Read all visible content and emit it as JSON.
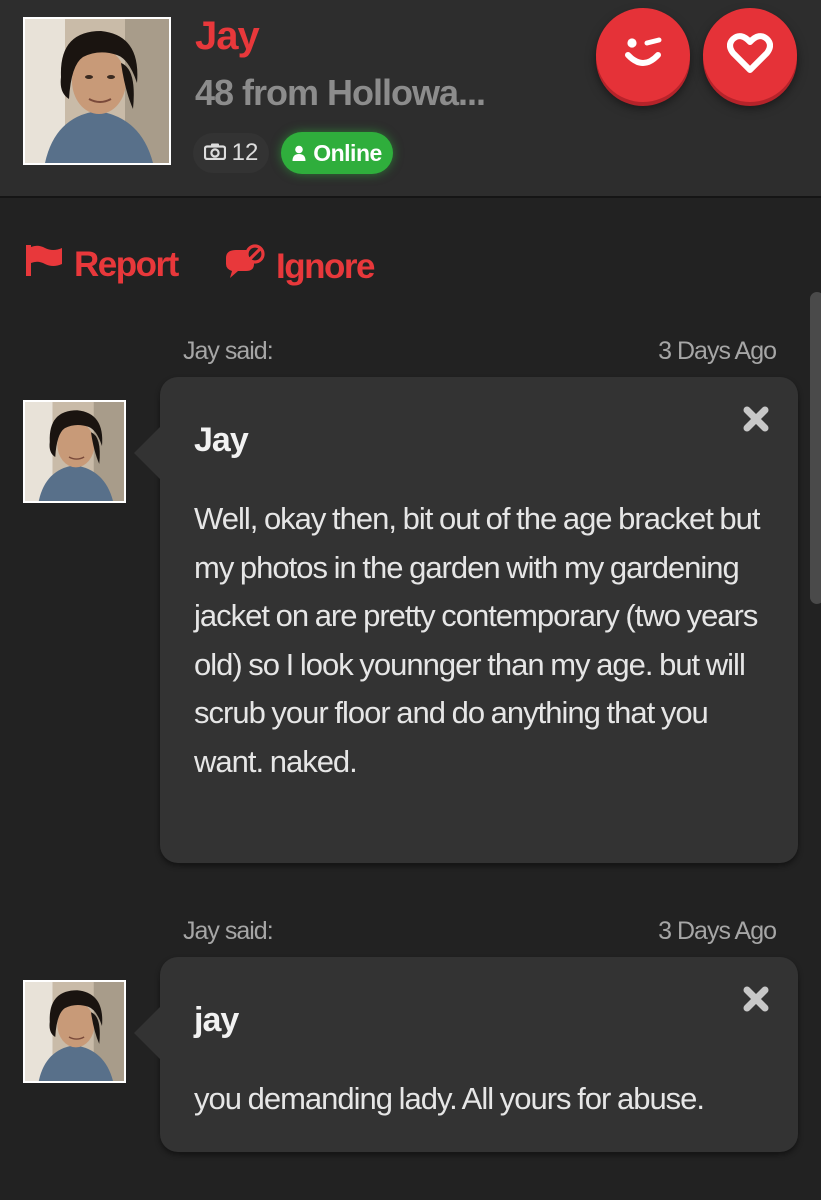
{
  "profile": {
    "name": "Jay",
    "subtitle": "48 from Hollowa...",
    "photo_count": "12",
    "status": "Online",
    "avatar": "profile-photo-man-dark-hair"
  },
  "header_actions": {
    "wink_icon": "wink-smile-icon",
    "favorite_icon": "heart-icon"
  },
  "actions": {
    "report_label": "Report",
    "report_icon": "flag-icon",
    "ignore_label": "Ignore",
    "ignore_icon": "ignore-chat-icon"
  },
  "messages": [
    {
      "said_label": "Jay said:",
      "time": "3 Days Ago",
      "sender": "Jay",
      "text": "Well, okay then, bit out of the age bracket but my photos in the garden with my gardening jacket on are pretty contemporary (two years old) so I look younnger than my age. but will scrub your floor and do anything that you want. naked."
    },
    {
      "said_label": "Jay said:",
      "time": "3 Days Ago",
      "sender": "jay",
      "text": "you demanding lady. All yours for abuse."
    }
  ],
  "colors": {
    "accent_red": "#e8383b",
    "online_green": "#2fae3c",
    "background": "#222222",
    "bubble": "#333333"
  }
}
